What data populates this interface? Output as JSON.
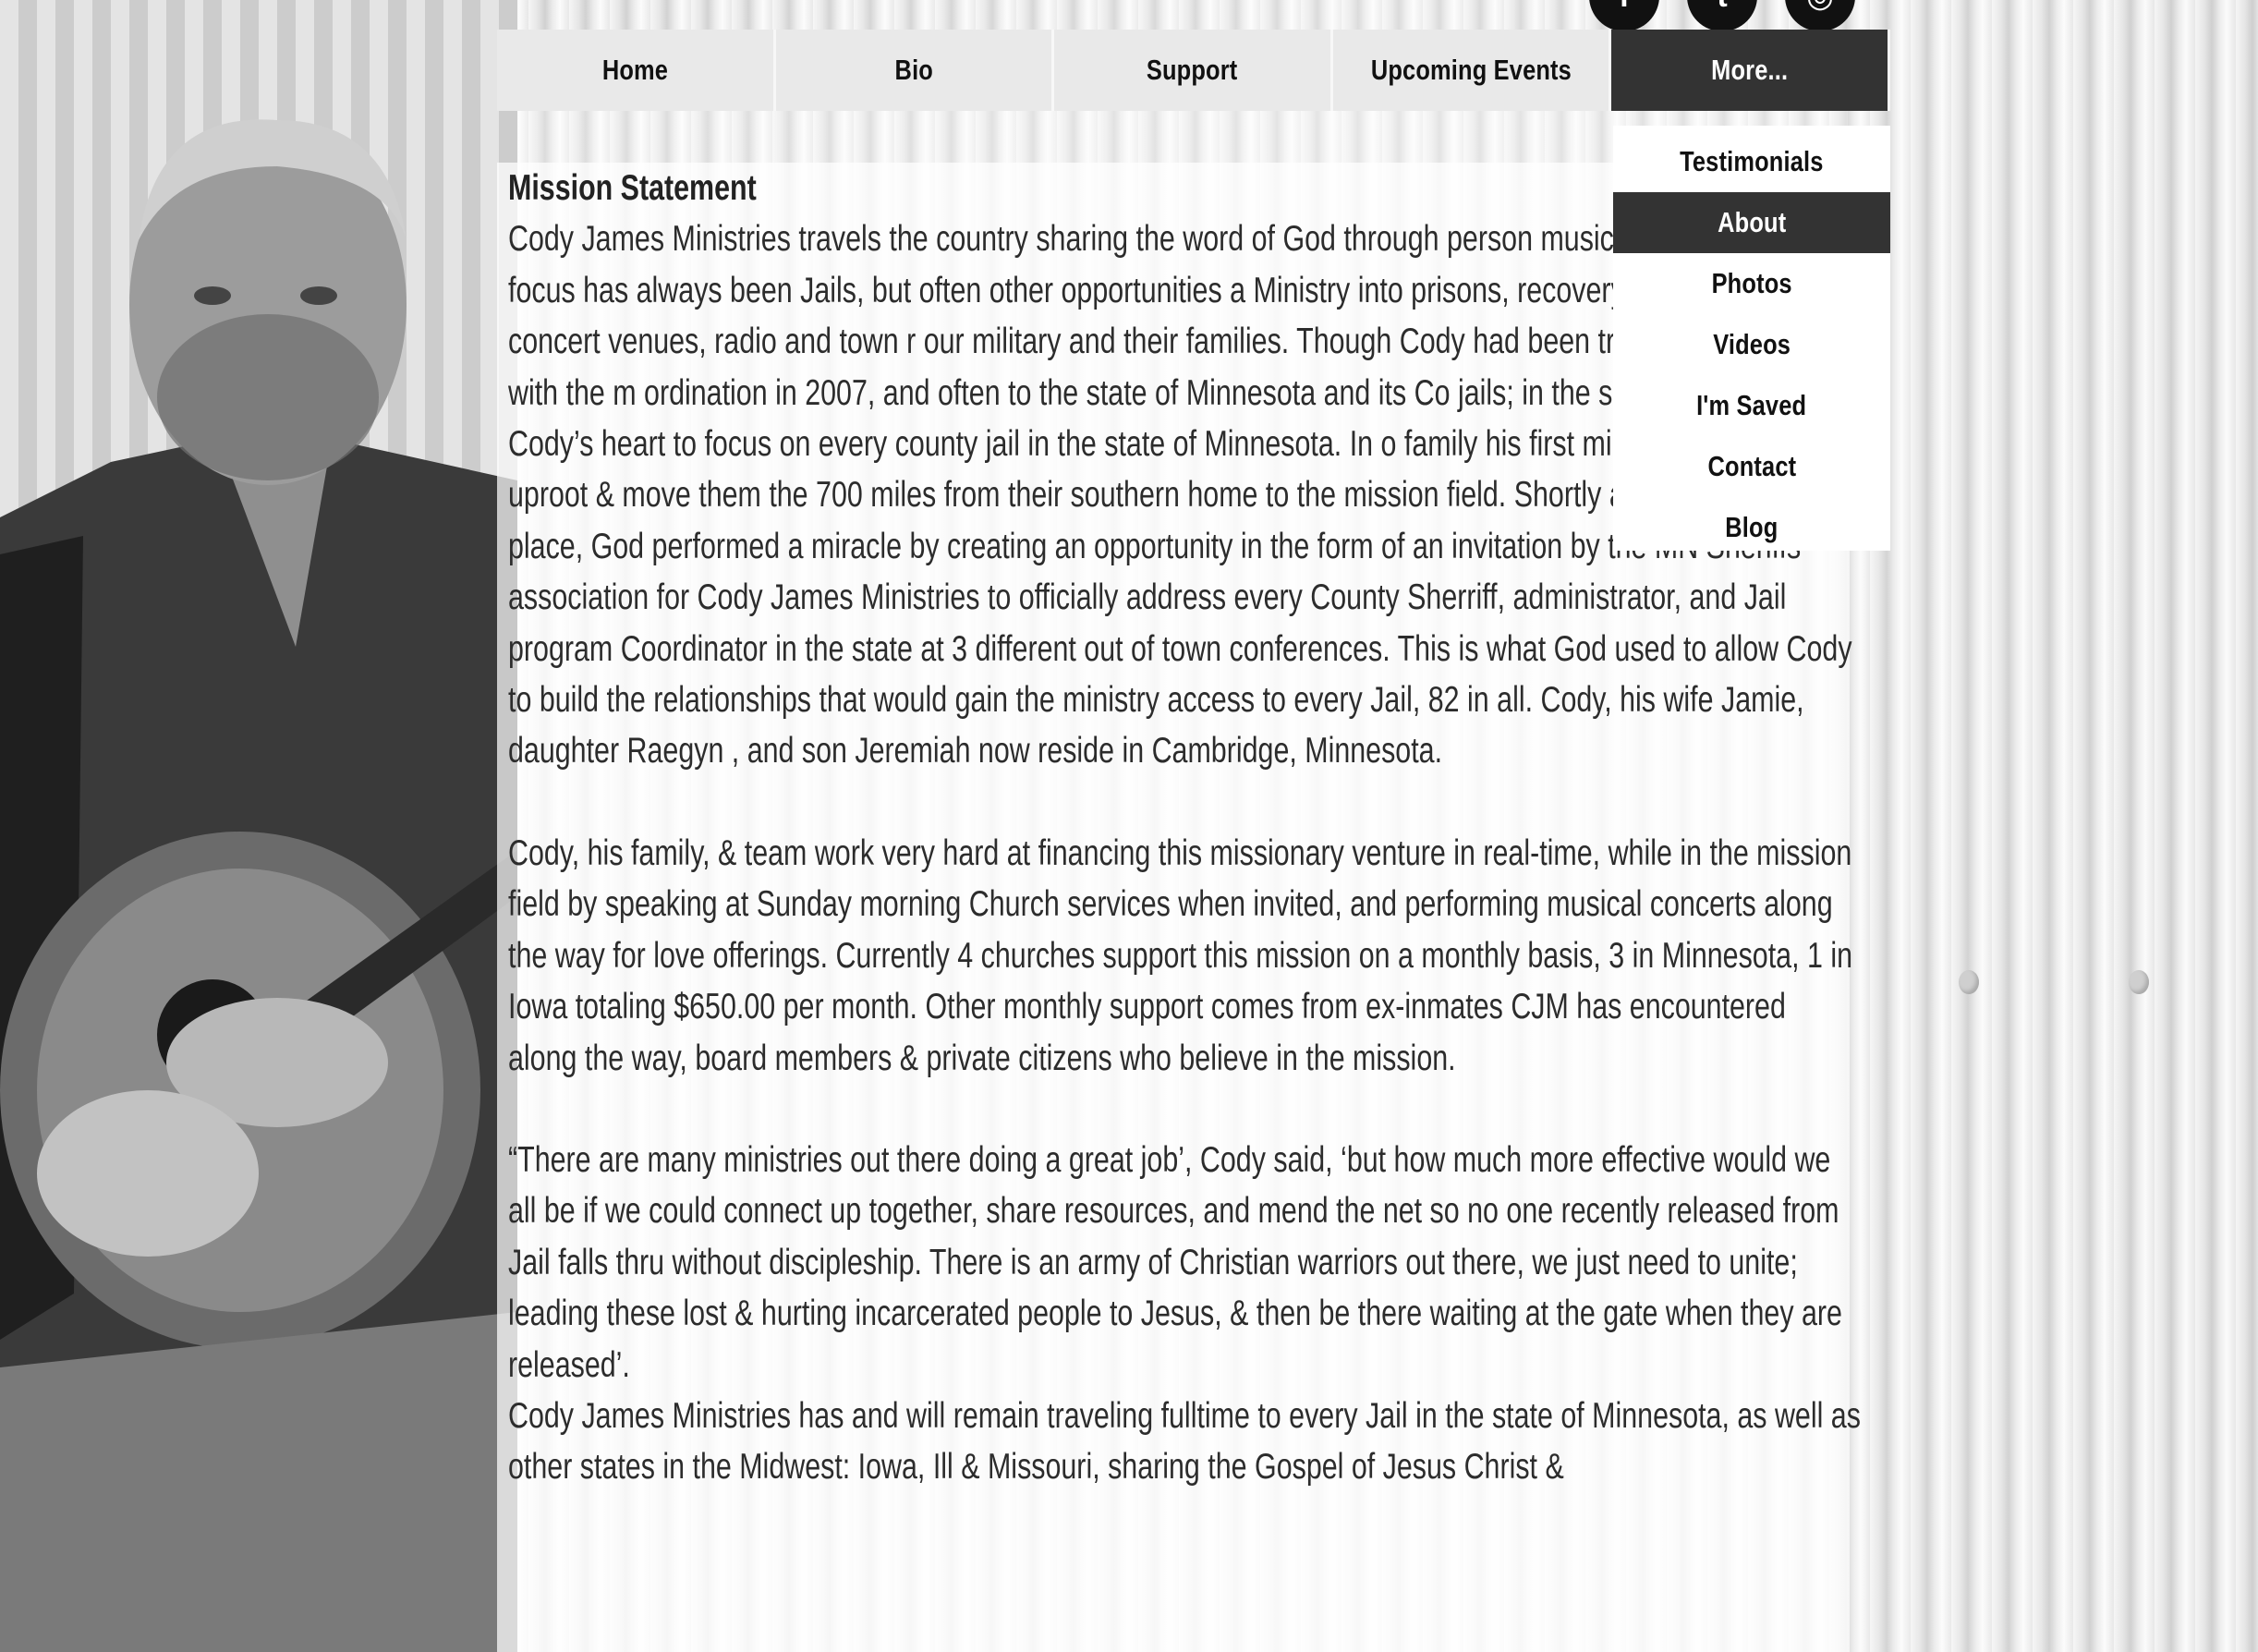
{
  "social": {
    "icons": [
      "facebook-icon",
      "twitter-icon",
      "instagram-icon"
    ],
    "glyphs": [
      "f",
      "t",
      "◎"
    ]
  },
  "nav": {
    "items": [
      {
        "label": "Home"
      },
      {
        "label": "Bio"
      },
      {
        "label": "Support"
      },
      {
        "label": "Upcoming Events"
      },
      {
        "label": "More..."
      }
    ],
    "active": "More...",
    "active_bg": "#333333"
  },
  "dropdown": {
    "items": [
      {
        "label": "Testimonials"
      },
      {
        "label": "About"
      },
      {
        "label": "Photos"
      },
      {
        "label": "Videos"
      },
      {
        "label": "I'm Saved"
      },
      {
        "label": "Contact"
      },
      {
        "label": "Blog"
      }
    ],
    "active": "About"
  },
  "content": {
    "heading": "Mission Statement",
    "para1": "Cody James Ministries travels the country sharing the word of God through person music. CJM’s Mission focus has always been Jails, but often other opportunities a Ministry into prisons, recovery groups, churches, concert venues, radio and town r our military and their families. Though Cody had been traveling full time with the m ordination in 2007, and often to the state of Minnesota and its Co jails; in the sumn moved on Cody’s heart to focus on every county jail in the state of Minnesota. In o family his first ministry, he had to uproot & move them the 700 miles from their southern home to the mission field. Shortly after the move took place, God performed a miracle by creating an opportunity in the form of an invitation by the MN Sheriffs association for Cody James Ministries to officially address every County Sherriff, administrator, and Jail program Coordinator in the state at 3 different out of town conferences. This is what God used to allow Cody to build the relationships that would gain the ministry access to every Jail, 82 in all. Cody, his wife Jamie, daughter Raegyn , and son Jeremiah  now reside in Cambridge, Minnesota.",
    "para2": "Cody, his family, & team work very hard at financing this missionary venture in real-time, while in the mission field by speaking at Sunday morning Church services when invited, and performing musical concerts along the way for love offerings. Currently 4 churches support this mission on a monthly basis, 3 in Minnesota, 1 in Iowa totaling $650.00 per month. Other monthly support comes from ex-inmates CJM has encountered along the way, board members & private citizens who believe in the mission.",
    "para3": "“There are many ministries out there doing a great job’, Cody said, ‘but how much more effective would we all be if we could connect up together, share resources, and mend the net so no one recently released from Jail falls thru without discipleship. There is an army of Christian warriors out there, we just need to unite; leading these lost & hurting incarcerated people to Jesus, & then be there waiting at the gate when they are released’.",
    "para4": "Cody James Ministries has and will remain traveling fulltime to every Jail in the state of Minnesota, as well as other states in the Midwest: Iowa, Ill & Missouri, sharing the Gospel of Jesus Christ &"
  }
}
